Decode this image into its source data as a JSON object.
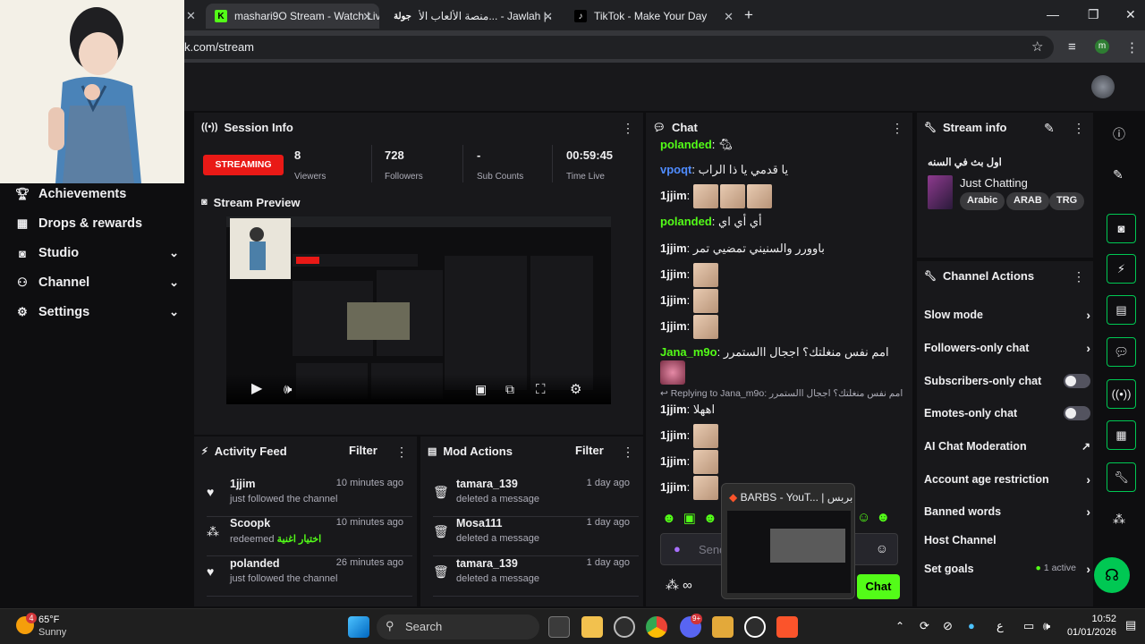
{
  "browser": {
    "tabs": [
      {
        "title": "mashari9O Stream - Watch Live"
      },
      {
        "title": "منصة الألعاب الأ... - Jawlah | جولة"
      },
      {
        "title": "TikTok - Make Your Day"
      }
    ],
    "url": "k.com/stream",
    "profile_initial": "m"
  },
  "sidebar": {
    "items": [
      {
        "label": "Achievements"
      },
      {
        "label": "Drops & rewards"
      },
      {
        "label": "Studio"
      },
      {
        "label": "Channel"
      },
      {
        "label": "Settings"
      }
    ]
  },
  "session": {
    "title": "Session Info",
    "status": "STREAMING",
    "viewers": "8",
    "viewers_label": "Viewers",
    "followers": "728",
    "followers_label": "Followers",
    "subs": "-",
    "subs_label": "Sub Counts",
    "time": "00:59:45",
    "time_label": "Time Live"
  },
  "preview": {
    "title": "Stream Preview"
  },
  "activity": {
    "title": "Activity Feed",
    "filter": "Filter",
    "items": [
      {
        "name": "1jjim",
        "desc": "just followed the channel",
        "time": "10 minutes ago"
      },
      {
        "name": "Scoopk",
        "desc": "redeemed",
        "reward": "اختيار اغنية",
        "time": "10 minutes ago"
      },
      {
        "name": "polanded",
        "desc": "just followed the channel",
        "time": "26 minutes ago"
      }
    ]
  },
  "mod": {
    "title": "Mod Actions",
    "filter": "Filter",
    "items": [
      {
        "name": "tamara_139",
        "desc": "deleted a message",
        "time": "1 day ago"
      },
      {
        "name": "Mosa111",
        "desc": "deleted a message",
        "time": "1 day ago"
      },
      {
        "name": "tamara_139",
        "desc": "deleted a message",
        "time": "1 day ago"
      }
    ]
  },
  "chat": {
    "title": "Chat",
    "messages": [
      {
        "user": "polanded",
        "text": ""
      },
      {
        "user": "vpoqt",
        "text": "يا قدمي يا ذا الراب"
      },
      {
        "user": "1jjim",
        "text": ""
      },
      {
        "user": "polanded",
        "text": "أي أي اي"
      },
      {
        "user": "1jjim",
        "text": "باوورر والسنيني تمضيي تمر"
      },
      {
        "user": "1jjim",
        "text": ""
      },
      {
        "user": "1jjim",
        "text": ""
      },
      {
        "user": "1jjim",
        "text": ""
      },
      {
        "user": "Jana_m9o",
        "text": "امم نفس منغلتك؟ اججال االستمرر"
      },
      {
        "user": "1jjim",
        "text": "اههلا"
      },
      {
        "user": "1jjim",
        "text": ""
      },
      {
        "user": "1jjim",
        "text": ""
      },
      {
        "user": "1jjim",
        "text": ""
      }
    ],
    "reply_label": "Replying to Jana_m9o:",
    "reply_text": "امم نفس منغلتك؟ اججال االستمرر",
    "input_placeholder": "Send a message",
    "send_label": "Chat",
    "popup_title": "BARBS - YouT... | بربس"
  },
  "stream_info": {
    "title": "Stream info",
    "stream_title": "اول بث في السنه",
    "category": "Just Chatting",
    "tags": [
      "Arabic",
      "ARAB",
      "TRG"
    ]
  },
  "channel_actions": {
    "title": "Channel Actions",
    "items": [
      {
        "label": "Slow mode",
        "control": "chevron"
      },
      {
        "label": "Followers-only chat",
        "control": "chevron"
      },
      {
        "label": "Subscribers-only chat",
        "control": "toggle"
      },
      {
        "label": "Emotes-only chat",
        "control": "toggle"
      },
      {
        "label": "AI Chat Moderation",
        "control": "external"
      },
      {
        "label": "Account age restriction",
        "control": "chevron"
      },
      {
        "label": "Banned words",
        "control": "chevron"
      },
      {
        "label": "Host Channel",
        "control": "none"
      },
      {
        "label": "Set goals",
        "control": "chevron"
      }
    ],
    "goals_status": "1 active"
  },
  "taskbar": {
    "weather_temp": "65°F",
    "weather_desc": "Sunny",
    "weather_badge": "4",
    "search_label": "Search",
    "time": "10:52",
    "date": "01/01/2026",
    "lang": "ع",
    "discord_badge": "9+"
  },
  "colors": {
    "accent": "#00c853",
    "streaming": "#e91916",
    "user_green": "#53fc18",
    "user_blue": "#4f8cff"
  }
}
